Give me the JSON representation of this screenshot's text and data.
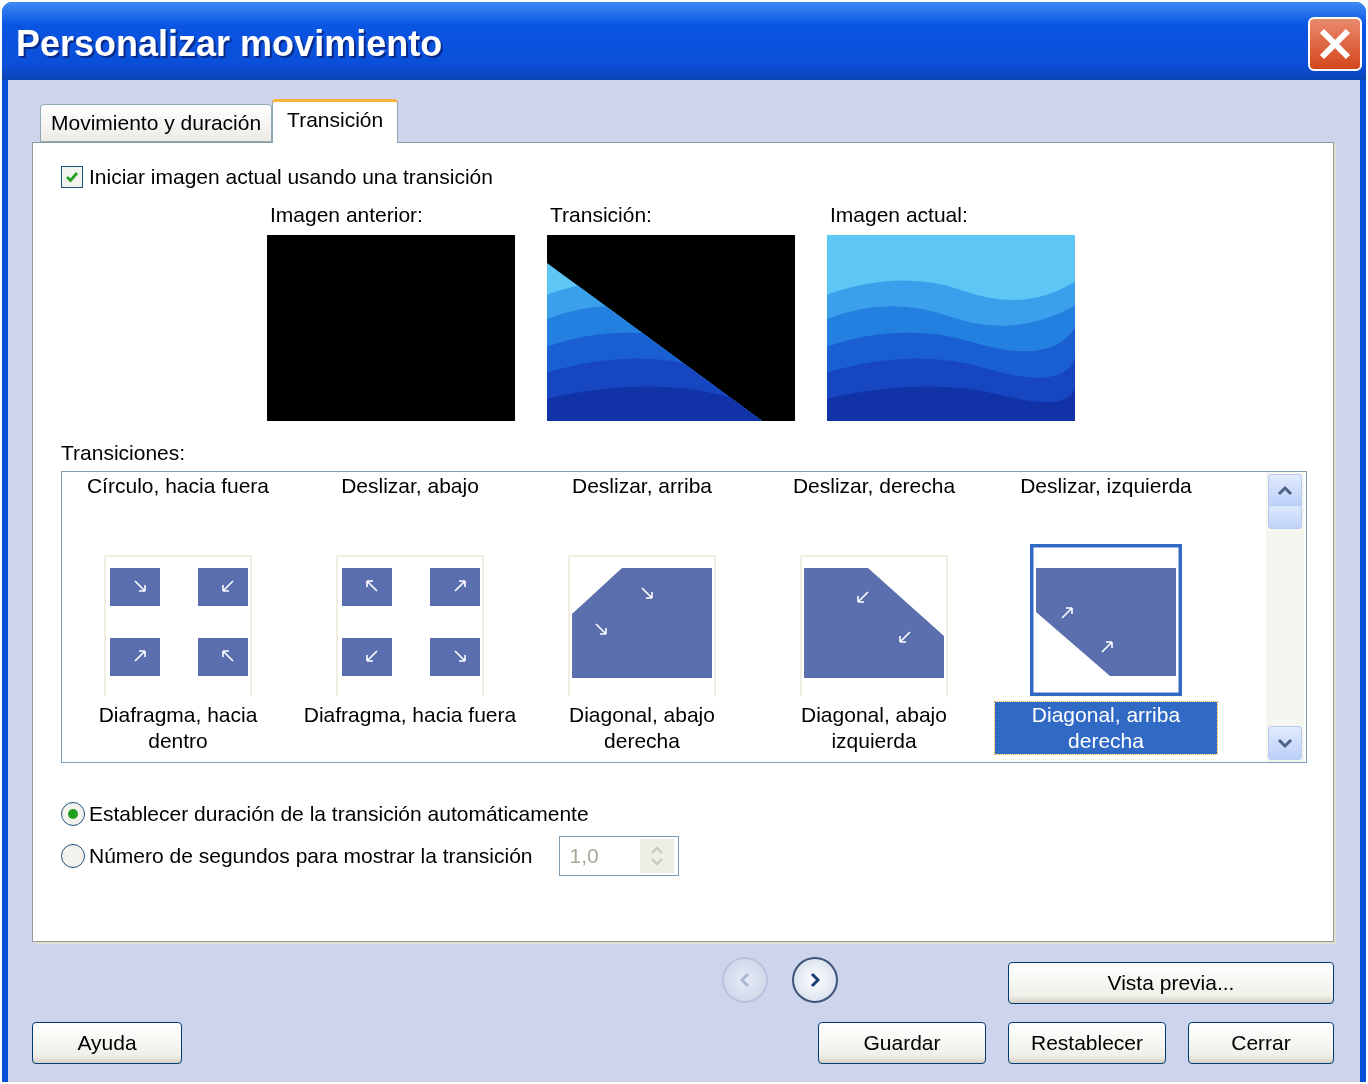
{
  "window": {
    "title": "Personalizar movimiento"
  },
  "tabs": [
    {
      "label": "Movimiento y duración",
      "selected": false
    },
    {
      "label": "Transición",
      "selected": true
    }
  ],
  "use_transition": {
    "label": "Iniciar imagen actual usando una transición",
    "checked": true
  },
  "previews": [
    {
      "label": "Imagen anterior:",
      "kind": "blank"
    },
    {
      "label": "Transición:",
      "kind": "wipe"
    },
    {
      "label": "Imagen actual:",
      "kind": "picture"
    }
  ],
  "transitions": {
    "label": "Transiciones:",
    "row_above_labels": [
      "Círculo, hacia fuera",
      "Deslizar, abajo",
      "Deslizar, arriba",
      "Deslizar, derecha",
      "Deslizar, izquierda"
    ],
    "items": [
      {
        "label": "Diafragma, hacia dentro",
        "kind": "iris-in",
        "selected": false
      },
      {
        "label": "Diafragma, hacia fuera",
        "kind": "iris-out",
        "selected": false
      },
      {
        "label": "Diagonal, abajo derecha",
        "kind": "diagonal-down-right",
        "selected": false
      },
      {
        "label": "Diagonal, abajo izquierda",
        "kind": "diagonal-down-left",
        "selected": false
      },
      {
        "label": "Diagonal, arriba derecha",
        "kind": "diagonal-up-right",
        "selected": true
      }
    ]
  },
  "duration": {
    "options": [
      {
        "label": "Establecer duración de la transición automáticamente",
        "selected": true
      },
      {
        "label": "Número de segundos para mostrar la transición",
        "selected": false
      }
    ],
    "seconds": {
      "value": "1,0",
      "disabled": true
    }
  },
  "navigation": [
    {
      "kind": "previous",
      "disabled": true
    },
    {
      "kind": "next",
      "disabled": false
    }
  ],
  "preview_button": "Vista previa...",
  "buttons": {
    "left": [
      "Ayuda"
    ],
    "right": [
      "Guardar",
      "Restablecer",
      "Cerrar"
    ]
  }
}
